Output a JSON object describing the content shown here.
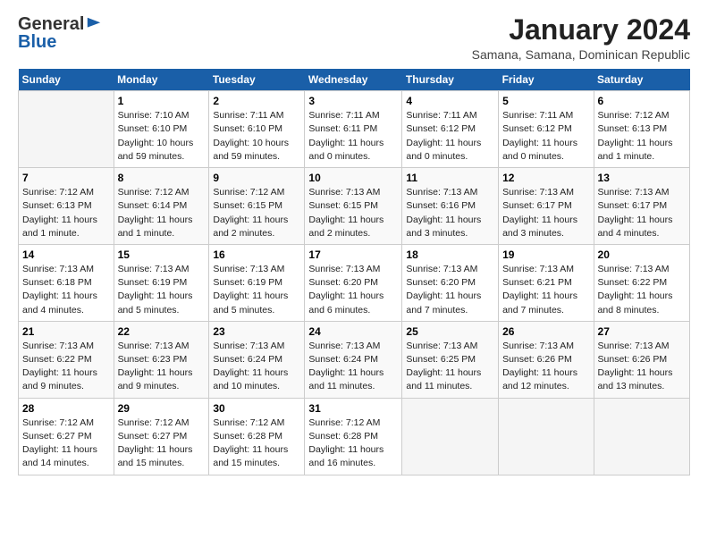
{
  "logo": {
    "general": "General",
    "blue": "Blue"
  },
  "title": "January 2024",
  "subtitle": "Samana, Samana, Dominican Republic",
  "header_days": [
    "Sunday",
    "Monday",
    "Tuesday",
    "Wednesday",
    "Thursday",
    "Friday",
    "Saturday"
  ],
  "weeks": [
    [
      {
        "day": "",
        "info": ""
      },
      {
        "day": "1",
        "info": "Sunrise: 7:10 AM\nSunset: 6:10 PM\nDaylight: 10 hours\nand 59 minutes."
      },
      {
        "day": "2",
        "info": "Sunrise: 7:11 AM\nSunset: 6:10 PM\nDaylight: 10 hours\nand 59 minutes."
      },
      {
        "day": "3",
        "info": "Sunrise: 7:11 AM\nSunset: 6:11 PM\nDaylight: 11 hours\nand 0 minutes."
      },
      {
        "day": "4",
        "info": "Sunrise: 7:11 AM\nSunset: 6:12 PM\nDaylight: 11 hours\nand 0 minutes."
      },
      {
        "day": "5",
        "info": "Sunrise: 7:11 AM\nSunset: 6:12 PM\nDaylight: 11 hours\nand 0 minutes."
      },
      {
        "day": "6",
        "info": "Sunrise: 7:12 AM\nSunset: 6:13 PM\nDaylight: 11 hours\nand 1 minute."
      }
    ],
    [
      {
        "day": "7",
        "info": "Sunrise: 7:12 AM\nSunset: 6:13 PM\nDaylight: 11 hours\nand 1 minute."
      },
      {
        "day": "8",
        "info": "Sunrise: 7:12 AM\nSunset: 6:14 PM\nDaylight: 11 hours\nand 1 minute."
      },
      {
        "day": "9",
        "info": "Sunrise: 7:12 AM\nSunset: 6:15 PM\nDaylight: 11 hours\nand 2 minutes."
      },
      {
        "day": "10",
        "info": "Sunrise: 7:13 AM\nSunset: 6:15 PM\nDaylight: 11 hours\nand 2 minutes."
      },
      {
        "day": "11",
        "info": "Sunrise: 7:13 AM\nSunset: 6:16 PM\nDaylight: 11 hours\nand 3 minutes."
      },
      {
        "day": "12",
        "info": "Sunrise: 7:13 AM\nSunset: 6:17 PM\nDaylight: 11 hours\nand 3 minutes."
      },
      {
        "day": "13",
        "info": "Sunrise: 7:13 AM\nSunset: 6:17 PM\nDaylight: 11 hours\nand 4 minutes."
      }
    ],
    [
      {
        "day": "14",
        "info": "Sunrise: 7:13 AM\nSunset: 6:18 PM\nDaylight: 11 hours\nand 4 minutes."
      },
      {
        "day": "15",
        "info": "Sunrise: 7:13 AM\nSunset: 6:19 PM\nDaylight: 11 hours\nand 5 minutes."
      },
      {
        "day": "16",
        "info": "Sunrise: 7:13 AM\nSunset: 6:19 PM\nDaylight: 11 hours\nand 5 minutes."
      },
      {
        "day": "17",
        "info": "Sunrise: 7:13 AM\nSunset: 6:20 PM\nDaylight: 11 hours\nand 6 minutes."
      },
      {
        "day": "18",
        "info": "Sunrise: 7:13 AM\nSunset: 6:20 PM\nDaylight: 11 hours\nand 7 minutes."
      },
      {
        "day": "19",
        "info": "Sunrise: 7:13 AM\nSunset: 6:21 PM\nDaylight: 11 hours\nand 7 minutes."
      },
      {
        "day": "20",
        "info": "Sunrise: 7:13 AM\nSunset: 6:22 PM\nDaylight: 11 hours\nand 8 minutes."
      }
    ],
    [
      {
        "day": "21",
        "info": "Sunrise: 7:13 AM\nSunset: 6:22 PM\nDaylight: 11 hours\nand 9 minutes."
      },
      {
        "day": "22",
        "info": "Sunrise: 7:13 AM\nSunset: 6:23 PM\nDaylight: 11 hours\nand 9 minutes."
      },
      {
        "day": "23",
        "info": "Sunrise: 7:13 AM\nSunset: 6:24 PM\nDaylight: 11 hours\nand 10 minutes."
      },
      {
        "day": "24",
        "info": "Sunrise: 7:13 AM\nSunset: 6:24 PM\nDaylight: 11 hours\nand 11 minutes."
      },
      {
        "day": "25",
        "info": "Sunrise: 7:13 AM\nSunset: 6:25 PM\nDaylight: 11 hours\nand 11 minutes."
      },
      {
        "day": "26",
        "info": "Sunrise: 7:13 AM\nSunset: 6:26 PM\nDaylight: 11 hours\nand 12 minutes."
      },
      {
        "day": "27",
        "info": "Sunrise: 7:13 AM\nSunset: 6:26 PM\nDaylight: 11 hours\nand 13 minutes."
      }
    ],
    [
      {
        "day": "28",
        "info": "Sunrise: 7:12 AM\nSunset: 6:27 PM\nDaylight: 11 hours\nand 14 minutes."
      },
      {
        "day": "29",
        "info": "Sunrise: 7:12 AM\nSunset: 6:27 PM\nDaylight: 11 hours\nand 15 minutes."
      },
      {
        "day": "30",
        "info": "Sunrise: 7:12 AM\nSunset: 6:28 PM\nDaylight: 11 hours\nand 15 minutes."
      },
      {
        "day": "31",
        "info": "Sunrise: 7:12 AM\nSunset: 6:28 PM\nDaylight: 11 hours\nand 16 minutes."
      },
      {
        "day": "",
        "info": ""
      },
      {
        "day": "",
        "info": ""
      },
      {
        "day": "",
        "info": ""
      }
    ]
  ]
}
